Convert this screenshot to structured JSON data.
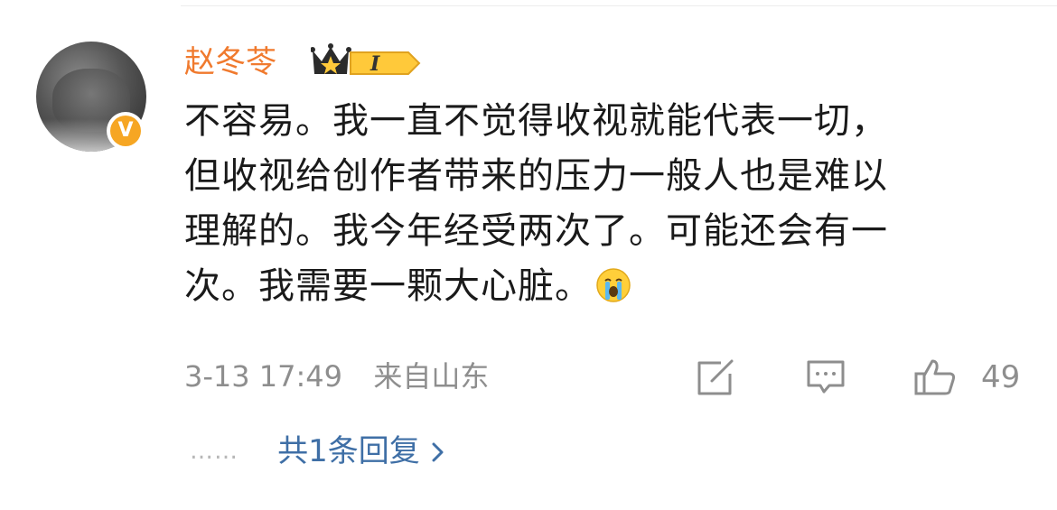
{
  "comment": {
    "username": "赵冬苓",
    "vip_level": "I",
    "verified_badge": "V",
    "text_lines": [
      "不容易。我一直不觉得收视就能代表一切，",
      "但收视给创作者带来的压力一般人也是难以",
      "理解的。我今年经受两次了。可能还会有一",
      "次。我需要一颗大心脏。"
    ],
    "emoji": "cry-emoji",
    "timestamp": "3-13 17:49",
    "location": "来自山东",
    "like_count": "49",
    "reply_dots": "……",
    "reply_link": "共1条回复"
  },
  "colors": {
    "username": "#f07a2e",
    "text": "#1a1a1a",
    "meta": "#8e8e8e",
    "link": "#3f6fa6",
    "badge_gold": "#f6a623"
  },
  "icons": {
    "share": "share-icon",
    "comment": "comment-icon",
    "like": "thumbs-up-icon",
    "chevron": "chevron-right-icon"
  }
}
